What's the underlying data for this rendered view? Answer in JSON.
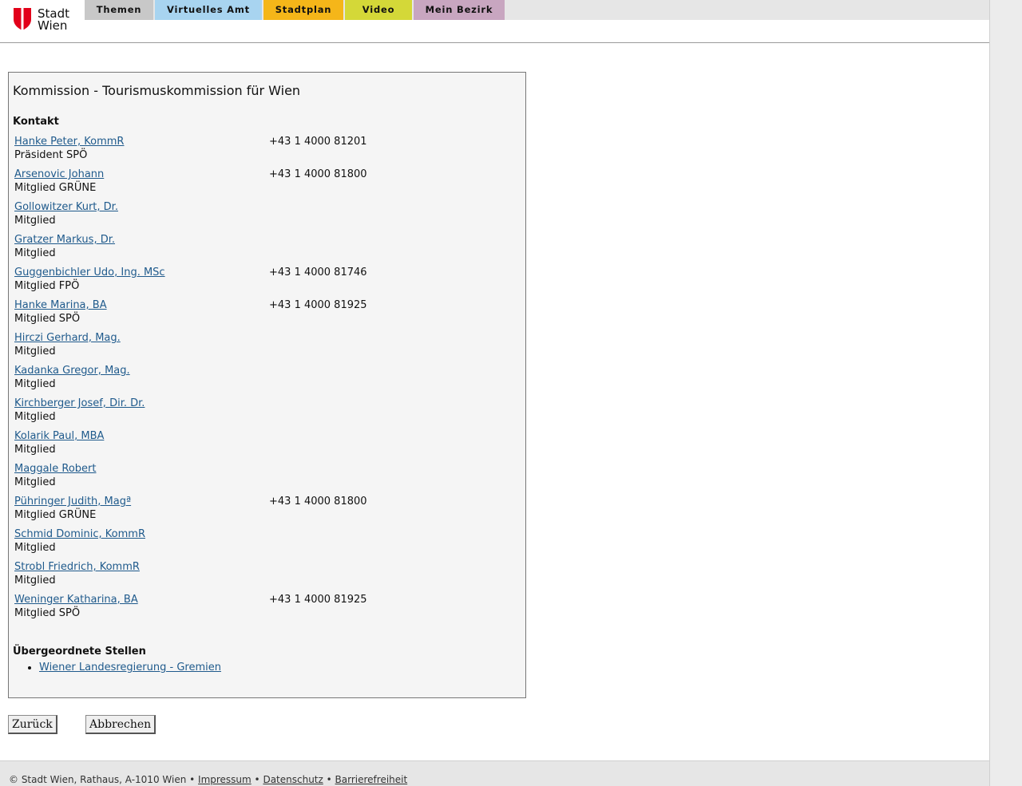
{
  "logo": {
    "line1": "Stadt",
    "line2": "Wien",
    "shield_color": "#e2001a"
  },
  "nav": {
    "tabs": [
      {
        "label": "Themen",
        "color": "#c8c8c8"
      },
      {
        "label": "Virtuelles Amt",
        "color": "#a8d4f0"
      },
      {
        "label": "Stadtplan",
        "color": "#f5b619"
      },
      {
        "label": "Video",
        "color": "#d4d838"
      },
      {
        "label": "Mein Bezirk",
        "color": "#c8a6c0"
      }
    ]
  },
  "main": {
    "title": "Kommission - Tourismuskommission für Wien",
    "contact_heading": "Kontakt",
    "contacts": [
      {
        "name": "Hanke Peter, KommR",
        "role": "Präsident SPÖ",
        "phone": "+43 1 4000 81201"
      },
      {
        "name": "Arsenovic Johann",
        "role": "Mitglied GRÜNE",
        "phone": "+43 1 4000 81800"
      },
      {
        "name": "Gollowitzer Kurt, Dr.",
        "role": "Mitglied",
        "phone": ""
      },
      {
        "name": "Gratzer Markus, Dr.",
        "role": "Mitglied",
        "phone": ""
      },
      {
        "name": "Guggenbichler Udo, Ing. MSc",
        "role": "Mitglied FPÖ",
        "phone": "+43 1 4000 81746"
      },
      {
        "name": "Hanke Marina, BA",
        "role": "Mitglied SPÖ",
        "phone": "+43 1 4000 81925"
      },
      {
        "name": "Hirczi Gerhard, Mag.",
        "role": "Mitglied",
        "phone": ""
      },
      {
        "name": "Kadanka Gregor, Mag.",
        "role": "Mitglied",
        "phone": ""
      },
      {
        "name": "Kirchberger Josef, Dir. Dr.",
        "role": "Mitglied",
        "phone": ""
      },
      {
        "name": "Kolarik Paul, MBA",
        "role": "Mitglied",
        "phone": ""
      },
      {
        "name": "Maggale Robert",
        "role": "Mitglied",
        "phone": ""
      },
      {
        "name": "Pühringer Judith, Magª",
        "role": "Mitglied GRÜNE",
        "phone": "+43 1 4000 81800"
      },
      {
        "name": "Schmid Dominic, KommR",
        "role": "Mitglied",
        "phone": ""
      },
      {
        "name": "Strobl Friedrich, KommR",
        "role": "Mitglied",
        "phone": ""
      },
      {
        "name": "Weninger Katharina, BA",
        "role": "Mitglied SPÖ",
        "phone": "+43 1 4000 81925"
      }
    ],
    "parent_heading": "Übergeordnete Stellen",
    "parent_links": [
      "Wiener Landesregierung - Gremien"
    ]
  },
  "buttons": {
    "back": "Zurück",
    "cancel": "Abbrechen"
  },
  "footer": {
    "copyright": "© Stadt Wien, Rathaus, A-1010 Wien",
    "separator": " • ",
    "links": [
      "Impressum",
      "Datenschutz",
      "Barrierefreiheit"
    ]
  }
}
